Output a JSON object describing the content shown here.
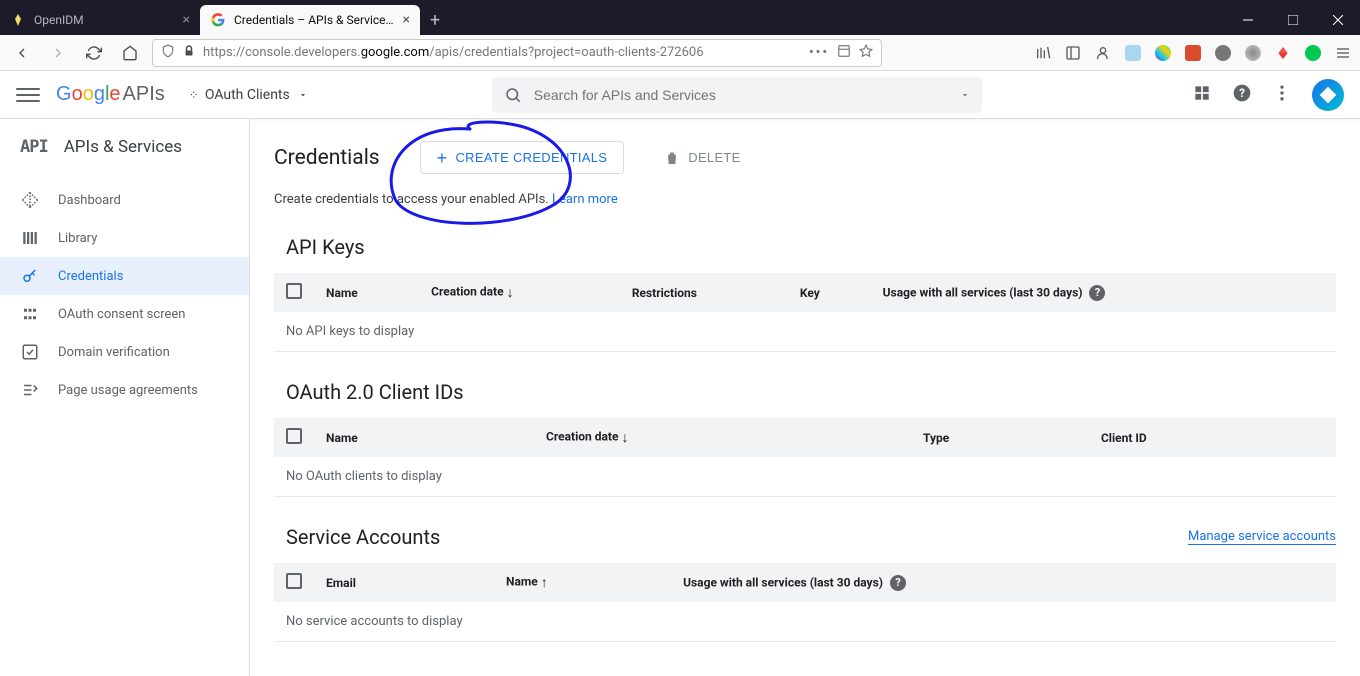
{
  "browser": {
    "tabs": [
      {
        "title": "OpenIDM",
        "active": false
      },
      {
        "title": "Credentials – APIs & Services –",
        "active": true
      }
    ],
    "url_prefix": "https://console.developers.",
    "url_bold": "google.com",
    "url_suffix": "/apis/credentials?project=oauth-clients-272606"
  },
  "header": {
    "logo_apis": "APIs",
    "project": "OAuth Clients",
    "search_placeholder": "Search for APIs and Services"
  },
  "sidebar": {
    "title": "APIs & Services",
    "logo": "API",
    "items": [
      {
        "label": "Dashboard"
      },
      {
        "label": "Library"
      },
      {
        "label": "Credentials"
      },
      {
        "label": "OAuth consent screen"
      },
      {
        "label": "Domain verification"
      },
      {
        "label": "Page usage agreements"
      }
    ]
  },
  "page": {
    "title": "Credentials",
    "create_btn": "CREATE CREDENTIALS",
    "delete_btn": "DELETE",
    "subtext": "Create credentials to access your enabled APIs.",
    "learn_more": "Learn more"
  },
  "sections": {
    "api_keys": {
      "title": "API Keys",
      "columns": [
        "Name",
        "Creation date",
        "Restrictions",
        "Key",
        "Usage with all services (last 30 days)"
      ],
      "empty": "No API keys to display"
    },
    "oauth": {
      "title": "OAuth 2.0 Client IDs",
      "columns": [
        "Name",
        "Creation date",
        "Type",
        "Client ID"
      ],
      "empty": "No OAuth clients to display"
    },
    "service": {
      "title": "Service Accounts",
      "manage": "Manage service accounts",
      "columns": [
        "Email",
        "Name",
        "Usage with all services (last 30 days)"
      ],
      "empty": "No service accounts to display"
    }
  }
}
